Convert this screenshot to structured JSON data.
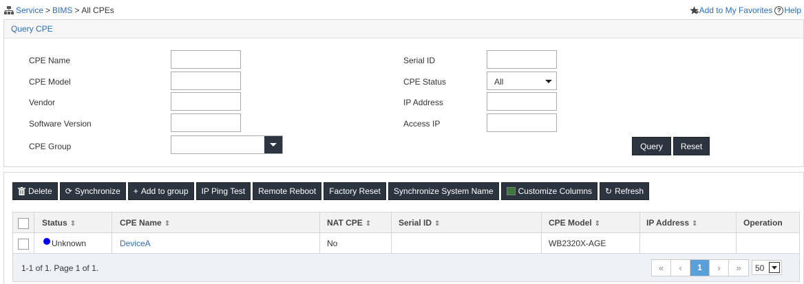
{
  "breadcrumb": {
    "items": [
      "Service",
      "BIMS"
    ],
    "current": "All CPEs",
    "separator": ">"
  },
  "top_links": {
    "favorites": "Add to My Favorites",
    "help": "Help"
  },
  "query": {
    "title": "Query CPE",
    "labels": {
      "cpe_name": "CPE Name",
      "cpe_model": "CPE Model",
      "vendor": "Vendor",
      "software_version": "Software Version",
      "cpe_group": "CPE Group",
      "serial_id": "Serial ID",
      "cpe_status": "CPE Status",
      "ip_address": "IP Address",
      "access_ip": "Access IP"
    },
    "cpe_status_value": "All",
    "query_button": "Query",
    "reset_button": "Reset"
  },
  "toolbar": {
    "delete": "Delete",
    "synchronize": "Synchronize",
    "add_to_group": "Add to group",
    "ip_ping_test": "IP Ping Test",
    "remote_reboot": "Remote Reboot",
    "factory_reset": "Factory Reset",
    "sync_system_name": "Synchronize System Name",
    "customize_columns": "Customize Columns",
    "refresh": "Refresh"
  },
  "table": {
    "headers": {
      "status": "Status",
      "cpe_name": "CPE Name",
      "nat_cpe": "NAT CPE",
      "serial_id": "Serial ID",
      "cpe_model": "CPE Model",
      "ip_address": "IP Address",
      "operation": "Operation"
    },
    "rows": [
      {
        "status": "Unknown",
        "status_color": "#0000ee",
        "cpe_name": "DeviceA",
        "nat_cpe": "No",
        "serial_id": "",
        "cpe_model": "WB2320X-AGE",
        "ip_address": "",
        "operation": ""
      }
    ],
    "footer": {
      "info": "1-1 of 1. Page 1 of 1.",
      "current_page": "1",
      "page_size": "50"
    }
  },
  "colors": {
    "accent": "#2a6ebb",
    "button_dark": "#2c3440",
    "page_active": "#5aa0d8"
  }
}
